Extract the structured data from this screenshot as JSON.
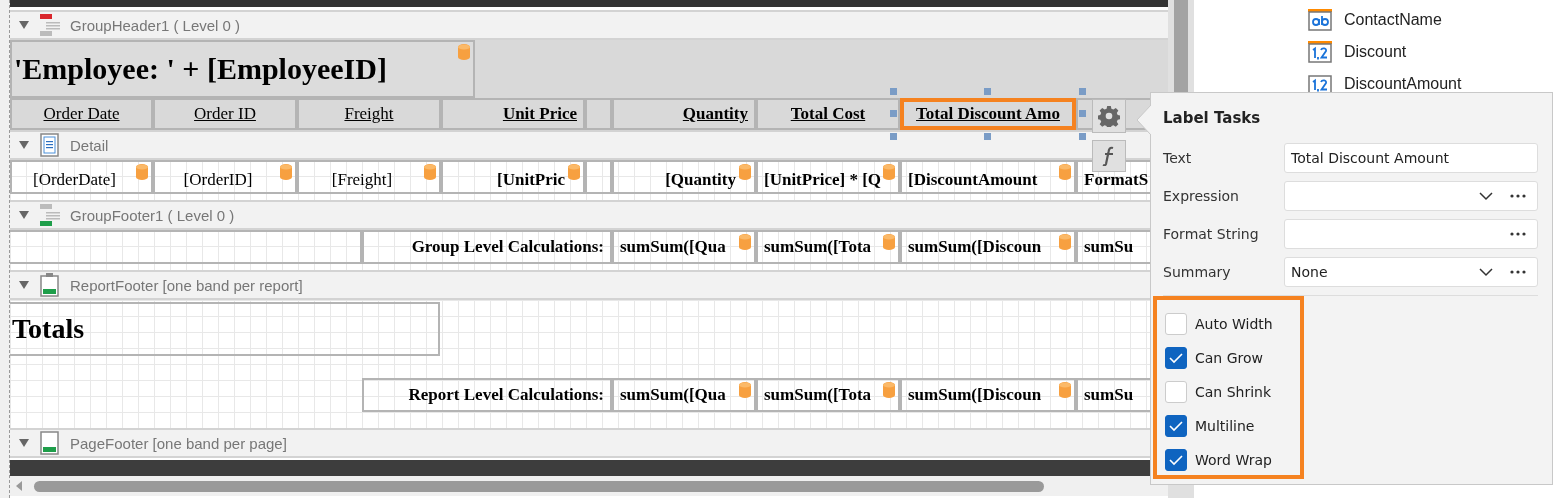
{
  "bands": [
    {
      "kind": "group_header",
      "title": "GroupHeader1 ( Level 0 )",
      "expanded": true
    },
    {
      "kind": "detail",
      "title": "Detail",
      "expanded": true
    },
    {
      "kind": "group_footer",
      "title": "GroupFooter1 ( Level 0 )",
      "expanded": true
    },
    {
      "kind": "report_footer",
      "title": "ReportFooter [one band per report]",
      "expanded": true
    },
    {
      "kind": "page_footer",
      "title": "PageFooter [one band per page]",
      "expanded": true
    }
  ],
  "employee_label": {
    "text": "'Employee: ' + [EmployeeID]",
    "bound": true
  },
  "column_headers": [
    {
      "text": "Order Date",
      "selected": false
    },
    {
      "text": "Order ID",
      "selected": false
    },
    {
      "text": "Freight",
      "selected": false
    },
    {
      "text": "Unit Price",
      "selected": false
    },
    {
      "text": "Quantity",
      "selected": false
    },
    {
      "text": "Total Cost",
      "selected": false
    },
    {
      "text": "Total Discount Amo",
      "selected": true
    }
  ],
  "detail_cells": [
    {
      "text": "[OrderDate]",
      "bound": true
    },
    {
      "text": "[OrderID]",
      "bound": true
    },
    {
      "text": "[Freight]",
      "bound": true
    },
    {
      "text": "[UnitPric",
      "bound": true
    },
    {
      "text": "[Quantity",
      "bound": true
    },
    {
      "text": "[UnitPrice] * [Q",
      "bound": true
    },
    {
      "text": "[DiscountAmount",
      "bound": true
    },
    {
      "text": "FormatS",
      "bound": false
    }
  ],
  "group_calc": {
    "label": "Group Level Calculations:",
    "cells": [
      {
        "text": "sumSum([Qua",
        "bound": true
      },
      {
        "text": "sumSum([Tota",
        "bound": true
      },
      {
        "text": "sumSum([Discoun",
        "bound": true
      },
      {
        "text": "sumSu",
        "bound": false
      }
    ]
  },
  "totals_label": "Totals",
  "report_calc": {
    "label": "Report Level Calculations:",
    "cells": [
      {
        "text": "sumSum([Qua",
        "bound": true
      },
      {
        "text": "sumSum([Tota",
        "bound": true
      },
      {
        "text": "sumSum([Discoun",
        "bound": true
      },
      {
        "text": "sumSu",
        "bound": false
      }
    ]
  },
  "field_list": [
    {
      "name": "ContactName",
      "kind": "string",
      "calculated": true
    },
    {
      "name": "Discount",
      "kind": "number",
      "calculated": true
    },
    {
      "name": "DiscountAmount",
      "kind": "number",
      "calculated": false
    }
  ],
  "label_tasks": {
    "title": "Label Tasks",
    "properties": [
      {
        "label": "Text",
        "kind": "text",
        "value": "Total Discount Amount"
      },
      {
        "label": "Expression",
        "kind": "combo"
      },
      {
        "label": "Format String",
        "kind": "ellipsis"
      },
      {
        "label": "Summary",
        "kind": "combo",
        "value": "None"
      }
    ],
    "options": [
      {
        "label": "Auto Width",
        "checked": false
      },
      {
        "label": "Can Grow",
        "checked": true
      },
      {
        "label": "Can Shrink",
        "checked": false
      },
      {
        "label": "Multiline",
        "checked": true
      },
      {
        "label": "Word Wrap",
        "checked": true
      }
    ]
  }
}
